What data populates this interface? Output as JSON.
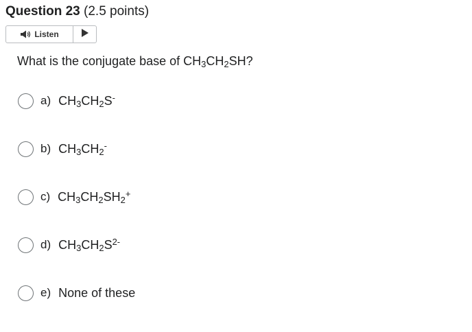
{
  "question": {
    "title": "Question 23",
    "points": "(2.5 points)",
    "prompt_prefix": "What is the conjugate base of CH",
    "prompt_sub1": "3",
    "prompt_mid": "CH",
    "prompt_sub2": "2",
    "prompt_suffix": "SH?"
  },
  "listen": {
    "label": "Listen",
    "speaker_icon": "speaker-icon",
    "play_icon": "play-icon"
  },
  "choices": [
    {
      "letter": "a)",
      "parts": {
        "p1": "CH",
        "s1": "3",
        "p2": "CH",
        "s2": "2",
        "p3": "S",
        "sup": "-"
      }
    },
    {
      "letter": "b)",
      "parts": {
        "p1": "CH",
        "s1": "3",
        "p2": "CH",
        "s2": "2",
        "sup": "-"
      }
    },
    {
      "letter": "c)",
      "parts": {
        "p1": "CH",
        "s1": "3",
        "p2": "CH",
        "s2": "2",
        "p3": "SH",
        "s3": "2",
        "sup": "+"
      }
    },
    {
      "letter": "d)",
      "parts": {
        "p1": "CH",
        "s1": "3",
        "p2": "CH",
        "s2": "2",
        "p3": "S",
        "sup": "2-"
      }
    },
    {
      "letter": "e)",
      "text": "None of these"
    }
  ],
  "colors": {
    "text": "#202122",
    "border": "#b9bcbf",
    "radio_border": "#6e7376",
    "icon": "#333333"
  }
}
